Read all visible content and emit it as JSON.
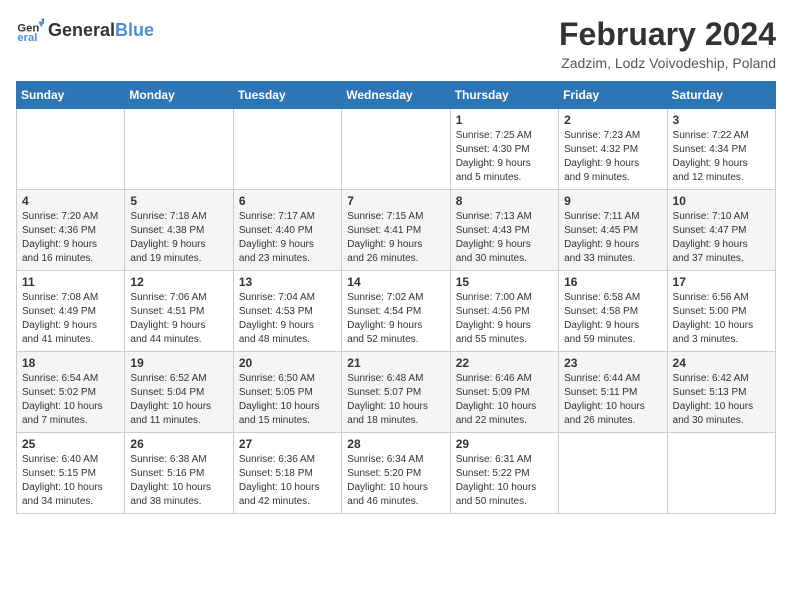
{
  "logo": {
    "text_general": "General",
    "text_blue": "Blue"
  },
  "title": {
    "month": "February 2024",
    "location": "Zadzim, Lodz Voivodeship, Poland"
  },
  "weekdays": [
    "Sunday",
    "Monday",
    "Tuesday",
    "Wednesday",
    "Thursday",
    "Friday",
    "Saturday"
  ],
  "weeks": [
    [
      {
        "day": "",
        "info": ""
      },
      {
        "day": "",
        "info": ""
      },
      {
        "day": "",
        "info": ""
      },
      {
        "day": "",
        "info": ""
      },
      {
        "day": "1",
        "info": "Sunrise: 7:25 AM\nSunset: 4:30 PM\nDaylight: 9 hours\nand 5 minutes."
      },
      {
        "day": "2",
        "info": "Sunrise: 7:23 AM\nSunset: 4:32 PM\nDaylight: 9 hours\nand 9 minutes."
      },
      {
        "day": "3",
        "info": "Sunrise: 7:22 AM\nSunset: 4:34 PM\nDaylight: 9 hours\nand 12 minutes."
      }
    ],
    [
      {
        "day": "4",
        "info": "Sunrise: 7:20 AM\nSunset: 4:36 PM\nDaylight: 9 hours\nand 16 minutes."
      },
      {
        "day": "5",
        "info": "Sunrise: 7:18 AM\nSunset: 4:38 PM\nDaylight: 9 hours\nand 19 minutes."
      },
      {
        "day": "6",
        "info": "Sunrise: 7:17 AM\nSunset: 4:40 PM\nDaylight: 9 hours\nand 23 minutes."
      },
      {
        "day": "7",
        "info": "Sunrise: 7:15 AM\nSunset: 4:41 PM\nDaylight: 9 hours\nand 26 minutes."
      },
      {
        "day": "8",
        "info": "Sunrise: 7:13 AM\nSunset: 4:43 PM\nDaylight: 9 hours\nand 30 minutes."
      },
      {
        "day": "9",
        "info": "Sunrise: 7:11 AM\nSunset: 4:45 PM\nDaylight: 9 hours\nand 33 minutes."
      },
      {
        "day": "10",
        "info": "Sunrise: 7:10 AM\nSunset: 4:47 PM\nDaylight: 9 hours\nand 37 minutes."
      }
    ],
    [
      {
        "day": "11",
        "info": "Sunrise: 7:08 AM\nSunset: 4:49 PM\nDaylight: 9 hours\nand 41 minutes."
      },
      {
        "day": "12",
        "info": "Sunrise: 7:06 AM\nSunset: 4:51 PM\nDaylight: 9 hours\nand 44 minutes."
      },
      {
        "day": "13",
        "info": "Sunrise: 7:04 AM\nSunset: 4:53 PM\nDaylight: 9 hours\nand 48 minutes."
      },
      {
        "day": "14",
        "info": "Sunrise: 7:02 AM\nSunset: 4:54 PM\nDaylight: 9 hours\nand 52 minutes."
      },
      {
        "day": "15",
        "info": "Sunrise: 7:00 AM\nSunset: 4:56 PM\nDaylight: 9 hours\nand 55 minutes."
      },
      {
        "day": "16",
        "info": "Sunrise: 6:58 AM\nSunset: 4:58 PM\nDaylight: 9 hours\nand 59 minutes."
      },
      {
        "day": "17",
        "info": "Sunrise: 6:56 AM\nSunset: 5:00 PM\nDaylight: 10 hours\nand 3 minutes."
      }
    ],
    [
      {
        "day": "18",
        "info": "Sunrise: 6:54 AM\nSunset: 5:02 PM\nDaylight: 10 hours\nand 7 minutes."
      },
      {
        "day": "19",
        "info": "Sunrise: 6:52 AM\nSunset: 5:04 PM\nDaylight: 10 hours\nand 11 minutes."
      },
      {
        "day": "20",
        "info": "Sunrise: 6:50 AM\nSunset: 5:05 PM\nDaylight: 10 hours\nand 15 minutes."
      },
      {
        "day": "21",
        "info": "Sunrise: 6:48 AM\nSunset: 5:07 PM\nDaylight: 10 hours\nand 18 minutes."
      },
      {
        "day": "22",
        "info": "Sunrise: 6:46 AM\nSunset: 5:09 PM\nDaylight: 10 hours\nand 22 minutes."
      },
      {
        "day": "23",
        "info": "Sunrise: 6:44 AM\nSunset: 5:11 PM\nDaylight: 10 hours\nand 26 minutes."
      },
      {
        "day": "24",
        "info": "Sunrise: 6:42 AM\nSunset: 5:13 PM\nDaylight: 10 hours\nand 30 minutes."
      }
    ],
    [
      {
        "day": "25",
        "info": "Sunrise: 6:40 AM\nSunset: 5:15 PM\nDaylight: 10 hours\nand 34 minutes."
      },
      {
        "day": "26",
        "info": "Sunrise: 6:38 AM\nSunset: 5:16 PM\nDaylight: 10 hours\nand 38 minutes."
      },
      {
        "day": "27",
        "info": "Sunrise: 6:36 AM\nSunset: 5:18 PM\nDaylight: 10 hours\nand 42 minutes."
      },
      {
        "day": "28",
        "info": "Sunrise: 6:34 AM\nSunset: 5:20 PM\nDaylight: 10 hours\nand 46 minutes."
      },
      {
        "day": "29",
        "info": "Sunrise: 6:31 AM\nSunset: 5:22 PM\nDaylight: 10 hours\nand 50 minutes."
      },
      {
        "day": "",
        "info": ""
      },
      {
        "day": "",
        "info": ""
      }
    ]
  ]
}
